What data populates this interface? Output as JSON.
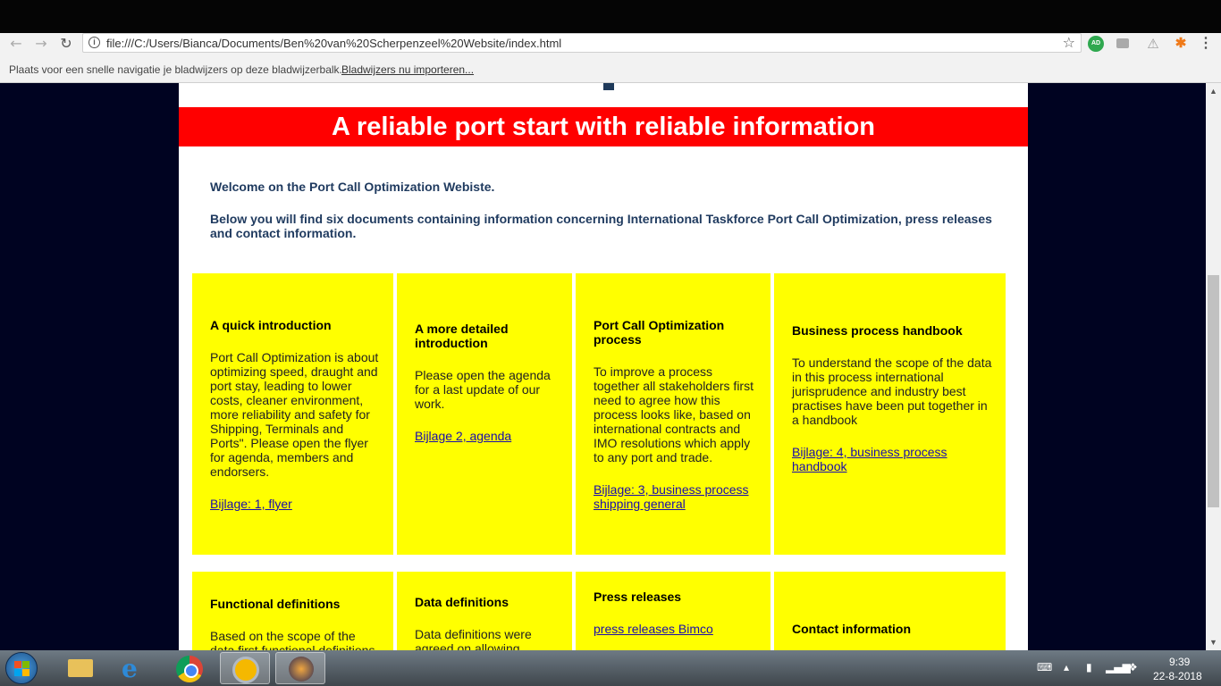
{
  "browser": {
    "url": "file:///C:/Users/Bianca/Documents/Ben%20van%20Scherpenzeel%20Website/index.html",
    "back_icon": "back-arrow-icon",
    "forward_icon": "forward-arrow-icon",
    "reload_icon": "reload-icon",
    "extension_ad_label": "AD",
    "bookmark_bar_text": "Plaats voor een snelle navigatie je bladwijzers op deze bladwijzerbalk.",
    "bookmark_import_link": "Bladwijzers nu importeren..."
  },
  "page": {
    "banner": "A reliable port start with reliable information",
    "intro_line1": "Welcome on the Port Call Optimization Webiste.",
    "intro_line2": "Below you will find six documents containing information concerning International Taskforce Port Call Optimization, press releases and contact information.",
    "cards": [
      {
        "title": "A quick introduction",
        "text": "Port Call Optimization is about optimizing speed, draught and port stay, leading to lower costs, cleaner environment, more reliability and safety for Shipping, Terminals and Ports\". Please open the flyer for agenda, members and endorsers.",
        "link": "Bijlage:  1, flyer"
      },
      {
        "title": "A more detailed introduction",
        "text": "Please open the agenda for a last update of our work.",
        "link": "Bijlage 2, agenda"
      },
      {
        "title": "Port Call Optimization process",
        "text": "To improve a process together all stakeholders first need to agree how this process looks like, based on international contracts and IMO resolutions which apply to any port and trade.",
        "link": "Bijlage: 3, business process shipping general"
      },
      {
        "title": "Business process handbook",
        "text": "To understand the scope of the data in this process international jurisprudence and industry best practises have been put together in a handbook",
        "link": "Bijlage: 4, business process handbook"
      },
      {
        "title": "Functional definitions",
        "text": "Based on the scope of the data first functional definitions"
      },
      {
        "title": "Data definitions",
        "text": "Data definitions were agreed on allowing"
      },
      {
        "title": "Press releases",
        "link": "press releases Bimco"
      },
      {
        "title": "Contact information"
      }
    ]
  },
  "taskbar": {
    "apps": [
      "windows-explorer",
      "internet-explorer",
      "google-chrome",
      "key-manager",
      "media-app"
    ],
    "clock_time": "9:39",
    "clock_date": "22-8-2018"
  }
}
